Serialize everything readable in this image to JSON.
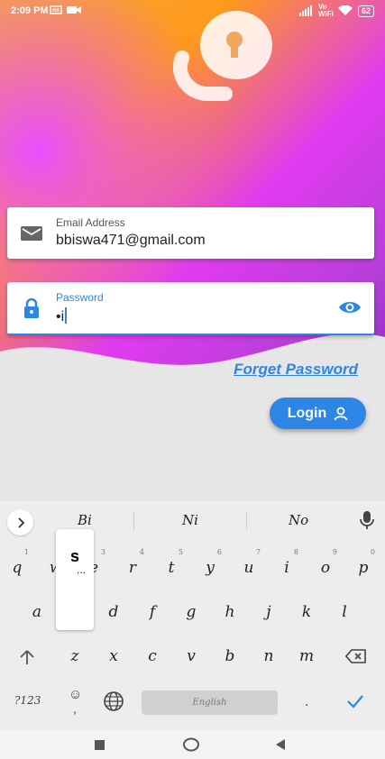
{
  "status_bar": {
    "time": "2:09 PM",
    "network": "Vo WiFi",
    "battery": "62"
  },
  "form": {
    "email": {
      "label": "Email Address",
      "value": "bbiswa471@gmail.com"
    },
    "password": {
      "label": "Password",
      "value": "•i"
    },
    "forget_label": "Forget Password",
    "login_label": "Login"
  },
  "keyboard": {
    "suggestions": [
      "Bi",
      "Ni",
      "No"
    ],
    "row1": [
      {
        "k": "q",
        "n": "1"
      },
      {
        "k": "w",
        "n": "2"
      },
      {
        "k": "e",
        "n": "3"
      },
      {
        "k": "r",
        "n": "4"
      },
      {
        "k": "t",
        "n": "5"
      },
      {
        "k": "y",
        "n": "6"
      },
      {
        "k": "u",
        "n": "7"
      },
      {
        "k": "i",
        "n": "8"
      },
      {
        "k": "o",
        "n": "9"
      },
      {
        "k": "p",
        "n": "0"
      }
    ],
    "row2": [
      "a",
      "s",
      "d",
      "f",
      "g",
      "h",
      "j",
      "k",
      "l"
    ],
    "row3": [
      "z",
      "x",
      "c",
      "v",
      "b",
      "n",
      "m"
    ],
    "popup_letter": "s",
    "popup_dots": "...",
    "symbols_label": "?123",
    "space_label": "English",
    "period_label": "."
  },
  "colors": {
    "accent": "#2d86e6",
    "gradient_start": "#f5a640",
    "gradient_end": "#e03bf0"
  }
}
